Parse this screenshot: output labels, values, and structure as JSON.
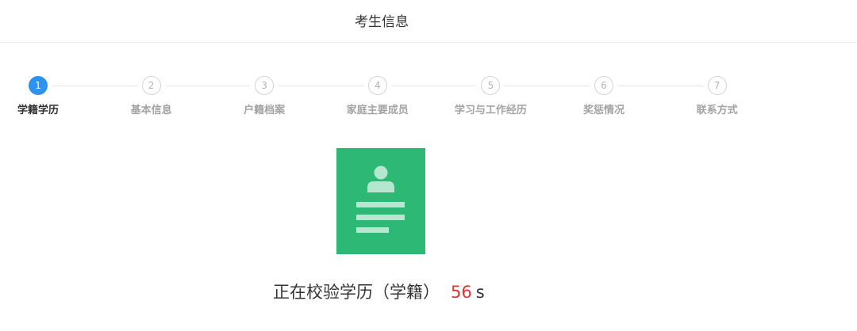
{
  "header": {
    "title": "考生信息"
  },
  "steps": [
    {
      "number": "1",
      "label": "学籍学历",
      "active": true
    },
    {
      "number": "2",
      "label": "基本信息",
      "active": false
    },
    {
      "number": "3",
      "label": "户籍档案",
      "active": false
    },
    {
      "number": "4",
      "label": "家庭主要成员",
      "active": false
    },
    {
      "number": "5",
      "label": "学习与工作经历",
      "active": false
    },
    {
      "number": "6",
      "label": "奖惩情况",
      "active": false
    },
    {
      "number": "7",
      "label": "联系方式",
      "active": false
    }
  ],
  "verification": {
    "icon": "profile-document-icon",
    "icon_color": "#2db975",
    "message": "正在校验学历（学籍）",
    "countdown": "56",
    "unit": "s"
  },
  "colors": {
    "active_step": "#2d93ee",
    "countdown": "#e0332e"
  }
}
